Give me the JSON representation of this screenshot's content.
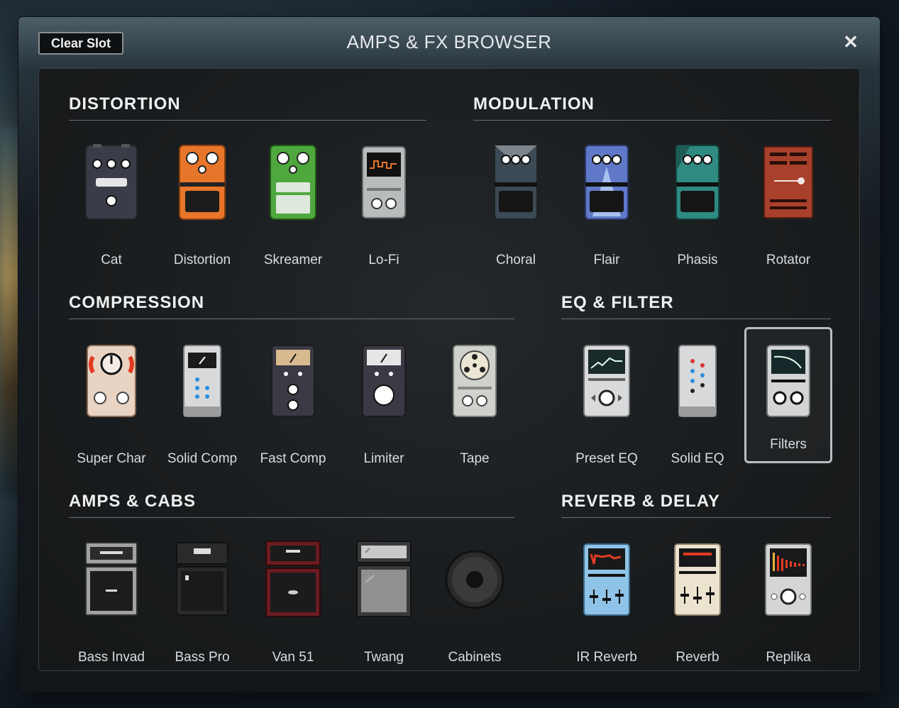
{
  "window": {
    "title": "AMPS & FX BROWSER",
    "clear_slot_label": "Clear Slot",
    "close_glyph": "✕"
  },
  "sections": {
    "distortion": {
      "title": "DISTORTION",
      "items": [
        "Cat",
        "Distortion",
        "Skreamer",
        "Lo-Fi"
      ]
    },
    "modulation": {
      "title": "MODULATION",
      "items": [
        "Choral",
        "Flair",
        "Phasis",
        "Rotator"
      ]
    },
    "compression": {
      "title": "COMPRESSION",
      "items": [
        "Super Char",
        "Solid Comp",
        "Fast Comp",
        "Limiter",
        "Tape"
      ]
    },
    "eq_filter": {
      "title": "EQ & FILTER",
      "items": [
        "Preset EQ",
        "Solid EQ",
        "Filters"
      ],
      "selected": "Filters"
    },
    "amps_cabs": {
      "title": "AMPS & CABS",
      "items": [
        "Bass Invad",
        "Bass Pro",
        "Van 51",
        "Twang",
        "Cabinets"
      ]
    },
    "reverb_delay": {
      "title": "REVERB & DELAY",
      "items": [
        "IR Reverb",
        "Reverb",
        "Replika"
      ]
    }
  },
  "icons": {
    "cat": "cat-pedal-icon",
    "distortion": "distortion-pedal-icon",
    "skreamer": "skreamer-pedal-icon",
    "lofi": "lofi-pedal-icon",
    "choral": "choral-pedal-icon",
    "flair": "flair-pedal-icon",
    "phasis": "phasis-pedal-icon",
    "rotator": "rotator-icon",
    "superchar": "super-char-icon",
    "solidcomp": "solid-comp-icon",
    "fastcomp": "fast-comp-icon",
    "limiter": "limiter-icon",
    "tape": "tape-icon",
    "preseteq": "preset-eq-icon",
    "solideq": "solid-eq-icon",
    "filters": "filters-icon",
    "bassinvad": "bass-invad-amp-icon",
    "basspro": "bass-pro-amp-icon",
    "van51": "van-51-amp-icon",
    "twang": "twang-amp-icon",
    "cabinets": "cabinet-speaker-icon",
    "irreverb": "ir-reverb-icon",
    "reverb": "reverb-icon",
    "replika": "replika-icon"
  },
  "colors": {
    "orange": "#e8762a",
    "green": "#4ea83e",
    "blue_accent": "#2a8fe0",
    "red": "#c0392b",
    "selected_border": "#b9bec2"
  }
}
